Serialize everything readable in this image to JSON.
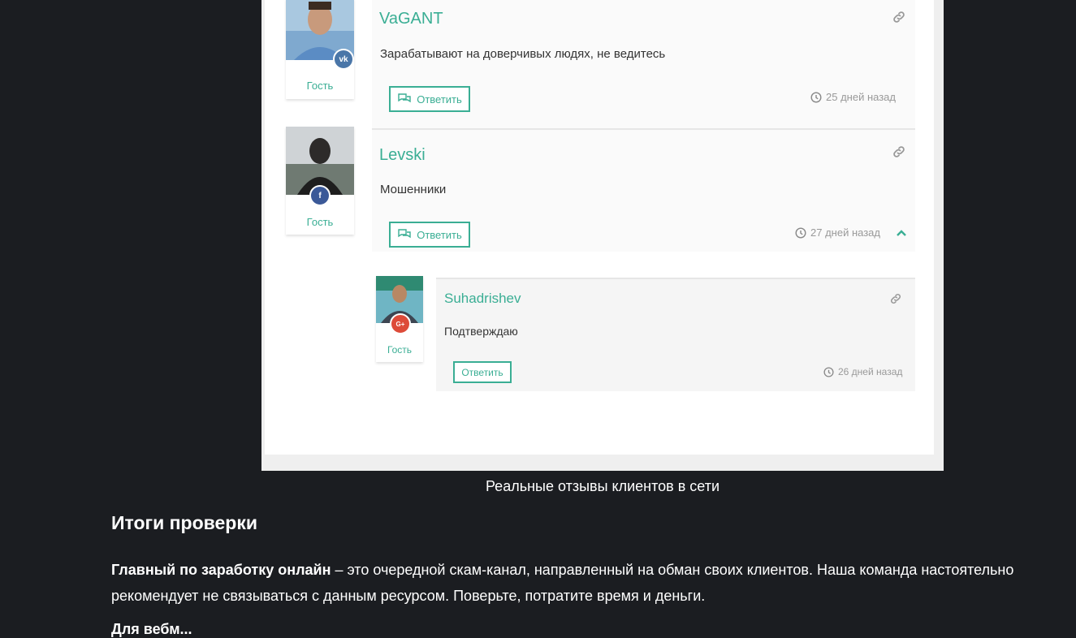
{
  "comments": [
    {
      "username": "VaGANT",
      "text": "Зарабатывают на доверчивых людях, не ведитесь",
      "role": "Гость",
      "social": "vk",
      "reply_label": "Ответить",
      "time": "25 дней назад"
    },
    {
      "username": "Levski",
      "text": "Мошенники",
      "role": "Гость",
      "social": "facebook",
      "reply_label": "Ответить",
      "time": "27 дней назад"
    },
    {
      "username": "Suhadrishev",
      "text": "Подтверждаю",
      "role": "Гость",
      "social": "google-plus",
      "reply_label": "Ответить",
      "time": "26 дней назад"
    }
  ],
  "social_badges": {
    "vk": "vk",
    "facebook": "f",
    "google_plus": "G+"
  },
  "colors": {
    "accent": "#3aae94",
    "page_bg": "#1b1d21",
    "vk": "#4a76a8",
    "facebook": "#3b5998",
    "google_plus": "#dd4b39"
  },
  "figure_caption": "Реальные отзывы клиентов в сети",
  "article": {
    "heading": "Итоги проверки",
    "para_bold": "Главный по заработку онлайн",
    "para_text": " – это очередной скам-канал, направленный на обман своих клиентов. Наша команда настоятельно рекомендует не связываться с данным ресурсом. Поверьте, потратите время и деньги.",
    "next_line_partial": "Для вебм..."
  }
}
